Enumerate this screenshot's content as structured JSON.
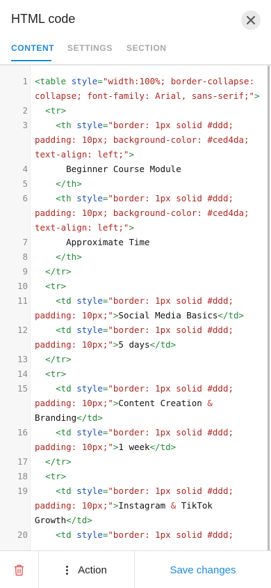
{
  "header": {
    "title": "HTML code",
    "close_icon": "close-icon"
  },
  "tabs": [
    {
      "label": "CONTENT",
      "active": true
    },
    {
      "label": "SETTINGS",
      "active": false
    },
    {
      "label": "SECTION",
      "active": false
    }
  ],
  "editor": {
    "lines": [
      {
        "num": "1",
        "tokens": [
          [
            "tag",
            "<table "
          ],
          [
            "attr",
            "style"
          ],
          [
            "tag",
            "="
          ],
          [
            "str",
            "\"width:100%; border-collapse: collapse; font-family: Arial, sans-serif;\""
          ],
          [
            "tag",
            ">"
          ]
        ]
      },
      {
        "num": "2",
        "tokens": [
          [
            "text",
            "  "
          ],
          [
            "tag",
            "<tr>"
          ]
        ]
      },
      {
        "num": "3",
        "tokens": [
          [
            "text",
            "    "
          ],
          [
            "tag",
            "<th "
          ],
          [
            "attr",
            "style"
          ],
          [
            "tag",
            "="
          ],
          [
            "str",
            "\"border: 1px solid #ddd; padding: 10px; background-color: #ced4da; text-align: left;\""
          ],
          [
            "tag",
            ">"
          ]
        ]
      },
      {
        "num": "4",
        "tokens": [
          [
            "text",
            "      Beginner Course Module"
          ]
        ]
      },
      {
        "num": "5",
        "tokens": [
          [
            "text",
            "    "
          ],
          [
            "tag",
            "</th>"
          ]
        ]
      },
      {
        "num": "6",
        "tokens": [
          [
            "text",
            "    "
          ],
          [
            "tag",
            "<th "
          ],
          [
            "attr",
            "style"
          ],
          [
            "tag",
            "="
          ],
          [
            "str",
            "\"border: 1px solid #ddd; padding: 10px; background-color: #ced4da; text-align: left;\""
          ],
          [
            "tag",
            ">"
          ]
        ]
      },
      {
        "num": "7",
        "tokens": [
          [
            "text",
            "      Approximate Time"
          ]
        ]
      },
      {
        "num": "8",
        "tokens": [
          [
            "text",
            "    "
          ],
          [
            "tag",
            "</th>"
          ]
        ]
      },
      {
        "num": "9",
        "tokens": [
          [
            "text",
            "  "
          ],
          [
            "tag",
            "</tr>"
          ]
        ]
      },
      {
        "num": "10",
        "tokens": [
          [
            "text",
            "  "
          ],
          [
            "tag",
            "<tr>"
          ]
        ]
      },
      {
        "num": "11",
        "tokens": [
          [
            "text",
            "    "
          ],
          [
            "tag",
            "<td "
          ],
          [
            "attr",
            "style"
          ],
          [
            "tag",
            "="
          ],
          [
            "str",
            "\"border: 1px solid #ddd; padding: 10px;\""
          ],
          [
            "tag",
            ">"
          ],
          [
            "text",
            "Social Media Basics"
          ],
          [
            "tag",
            "</td>"
          ]
        ]
      },
      {
        "num": "12",
        "tokens": [
          [
            "text",
            "    "
          ],
          [
            "tag",
            "<td "
          ],
          [
            "attr",
            "style"
          ],
          [
            "tag",
            "="
          ],
          [
            "str",
            "\"border: 1px solid #ddd; padding: 10px;\""
          ],
          [
            "tag",
            ">"
          ],
          [
            "text",
            "5 days"
          ],
          [
            "tag",
            "</td>"
          ]
        ]
      },
      {
        "num": "13",
        "tokens": [
          [
            "text",
            "  "
          ],
          [
            "tag",
            "</tr>"
          ]
        ]
      },
      {
        "num": "14",
        "tokens": [
          [
            "text",
            "  "
          ],
          [
            "tag",
            "<tr>"
          ]
        ]
      },
      {
        "num": "15",
        "tokens": [
          [
            "text",
            "    "
          ],
          [
            "tag",
            "<td "
          ],
          [
            "attr",
            "style"
          ],
          [
            "tag",
            "="
          ],
          [
            "str",
            "\"border: 1px solid #ddd; padding: 10px;\""
          ],
          [
            "tag",
            ">"
          ],
          [
            "text",
            "Content Creation "
          ],
          [
            "amp",
            "&"
          ],
          [
            "text",
            " Branding"
          ],
          [
            "tag",
            "</td>"
          ]
        ]
      },
      {
        "num": "16",
        "tokens": [
          [
            "text",
            "    "
          ],
          [
            "tag",
            "<td "
          ],
          [
            "attr",
            "style"
          ],
          [
            "tag",
            "="
          ],
          [
            "str",
            "\"border: 1px solid #ddd; padding: 10px;\""
          ],
          [
            "tag",
            ">"
          ],
          [
            "text",
            "1 week"
          ],
          [
            "tag",
            "</td>"
          ]
        ]
      },
      {
        "num": "17",
        "tokens": [
          [
            "text",
            "  "
          ],
          [
            "tag",
            "</tr>"
          ]
        ]
      },
      {
        "num": "18",
        "tokens": [
          [
            "text",
            "  "
          ],
          [
            "tag",
            "<tr>"
          ]
        ]
      },
      {
        "num": "19",
        "tokens": [
          [
            "text",
            "    "
          ],
          [
            "tag",
            "<td "
          ],
          [
            "attr",
            "style"
          ],
          [
            "tag",
            "="
          ],
          [
            "str",
            "\"border: 1px solid #ddd; padding: 10px;\""
          ],
          [
            "tag",
            ">"
          ],
          [
            "text",
            "Instagram "
          ],
          [
            "amp",
            "&"
          ],
          [
            "text",
            " TikTok Growth"
          ],
          [
            "tag",
            "</td>"
          ]
        ]
      },
      {
        "num": "20",
        "tokens": [
          [
            "text",
            "    "
          ],
          [
            "tag",
            "<td "
          ],
          [
            "attr",
            "style"
          ],
          [
            "tag",
            "="
          ],
          [
            "str",
            "\"border: 1px solid #ddd;"
          ]
        ]
      }
    ]
  },
  "footer": {
    "delete_icon": "trash-icon",
    "action_label": "Action",
    "save_label": "Save changes"
  },
  "colors": {
    "accent": "#1a8be0",
    "danger": "#e05a5a",
    "tag": "#1f8a34",
    "attr": "#1d4fb8",
    "string": "#b2251f"
  }
}
